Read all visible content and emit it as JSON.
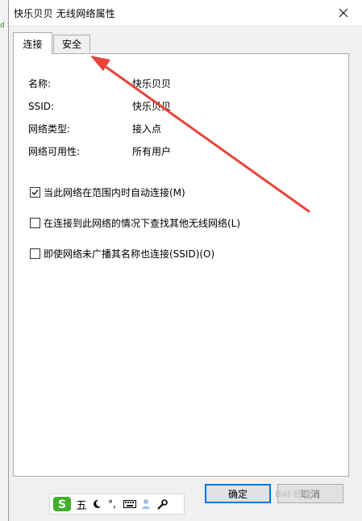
{
  "window": {
    "title": "快乐贝贝 无线网络属性"
  },
  "background_window": {
    "fragment": "d"
  },
  "tabs": [
    {
      "label": "连接",
      "active": true
    },
    {
      "label": "安全",
      "active": false
    }
  ],
  "properties": [
    {
      "label": "名称:",
      "value": "快乐贝贝"
    },
    {
      "label": "SSID:",
      "value": "快乐贝贝"
    },
    {
      "label": "网络类型:",
      "value": "接入点"
    },
    {
      "label": "网络可用性:",
      "value": "所有用户"
    }
  ],
  "options": [
    {
      "label": "当此网络在范围内时自动连接(M)",
      "checked": true
    },
    {
      "label": "在连接到此网络的情况下查找其他无线网络(L)",
      "checked": false
    },
    {
      "label": "即使网络未广播其名称也连接(SSID)(O)",
      "checked": false
    }
  ],
  "buttons": {
    "ok": "确定",
    "cancel": "取消"
  },
  "ime_toolbar": {
    "wubi_char": "五",
    "punct": "°,"
  },
  "annotation": {
    "arrow_color": "#e8433a"
  },
  "watermark": "Bai 经验"
}
